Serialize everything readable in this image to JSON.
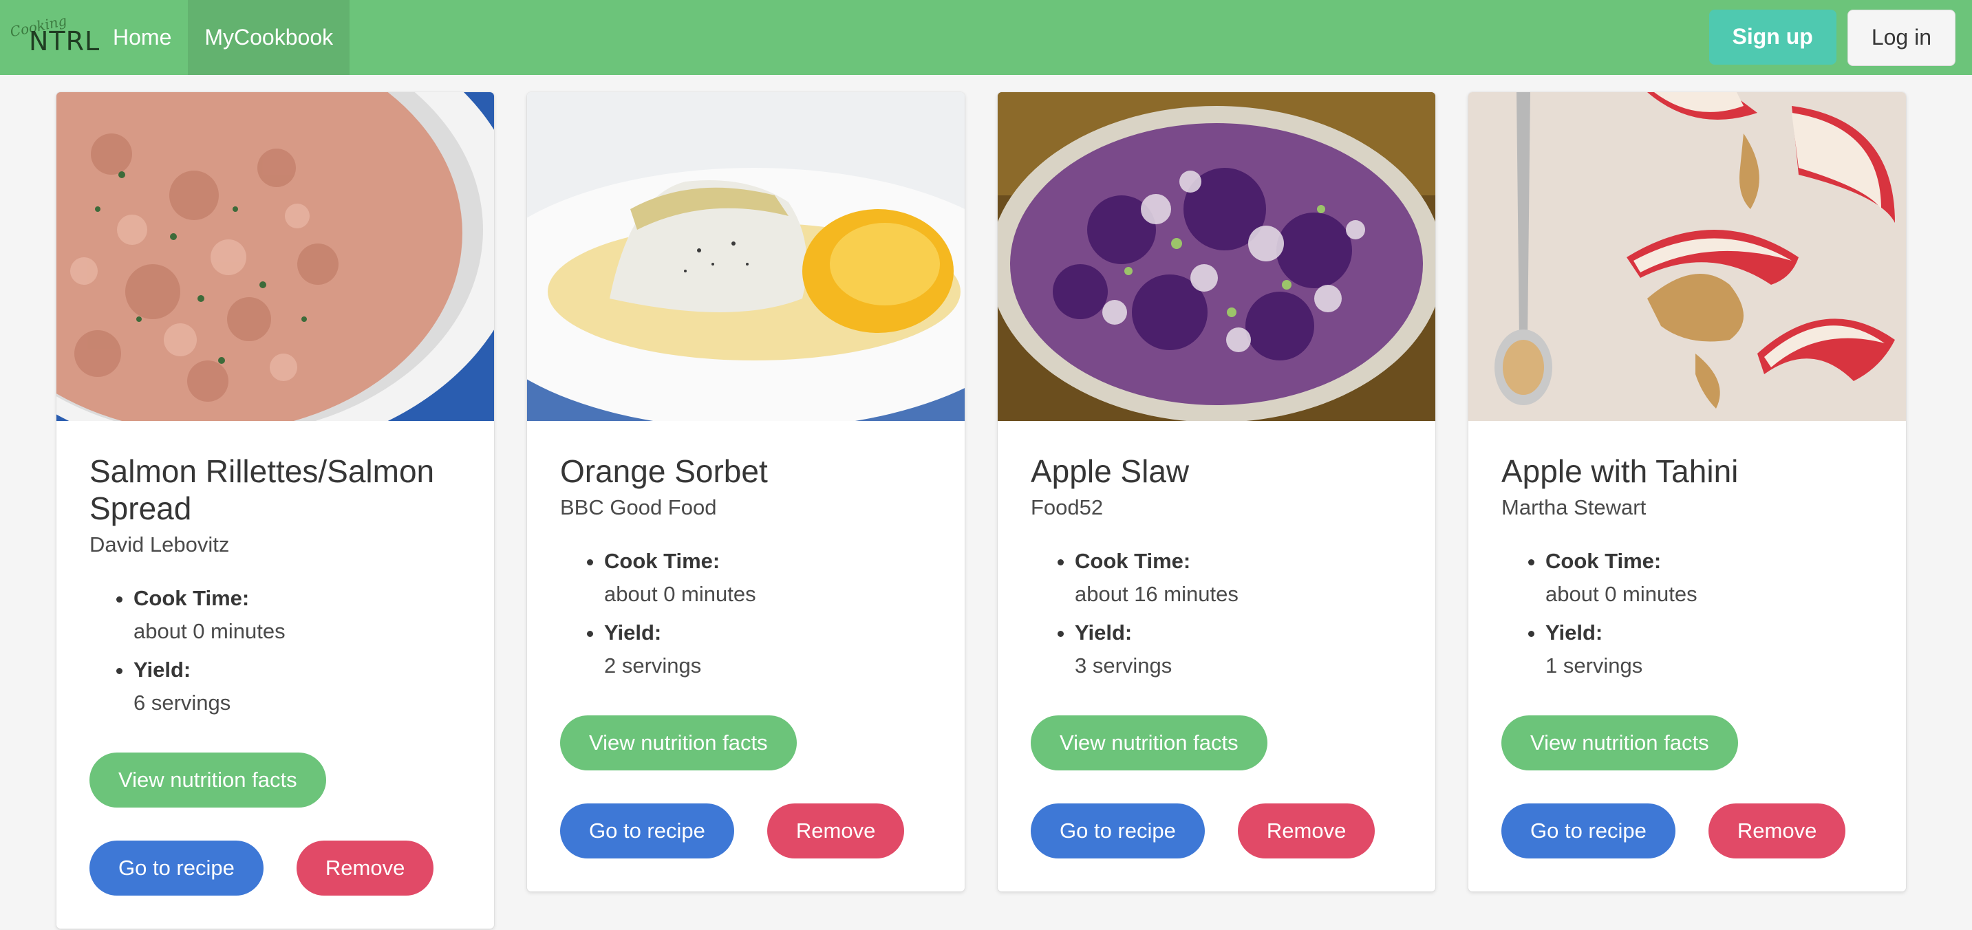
{
  "nav": {
    "brand_script": "Cooking",
    "brand_main": "NTRL",
    "home": "Home",
    "mycookbook": "MyCookbook",
    "signup": "Sign up",
    "login": "Log in"
  },
  "labels": {
    "cook_time": "Cook Time:",
    "yield": "Yield:",
    "nutrition": "View nutrition facts",
    "goto": "Go to recipe",
    "remove": "Remove"
  },
  "recipes": [
    {
      "title": "Salmon Rillettes/Salmon Spread",
      "source": "David Lebovitz",
      "cook_time": "about 0 minutes",
      "yield": "6 servings",
      "image": "salmon-spread-photo"
    },
    {
      "title": "Orange Sorbet",
      "source": "BBC Good Food",
      "cook_time": "about 0 minutes",
      "yield": "2 servings",
      "image": "orange-sorbet-photo"
    },
    {
      "title": "Apple Slaw",
      "source": "Food52",
      "cook_time": "about 16 minutes",
      "yield": "3 servings",
      "image": "apple-slaw-photo"
    },
    {
      "title": "Apple with Tahini",
      "source": "Martha Stewart",
      "cook_time": "about 0 minutes",
      "yield": "1 servings",
      "image": "apple-tahini-photo"
    }
  ],
  "colors": {
    "navbar": "#6cc47a",
    "signup": "#4fc9b0",
    "nutrition": "#6cc47a",
    "goto": "#3e78d6",
    "remove": "#e14a67"
  }
}
